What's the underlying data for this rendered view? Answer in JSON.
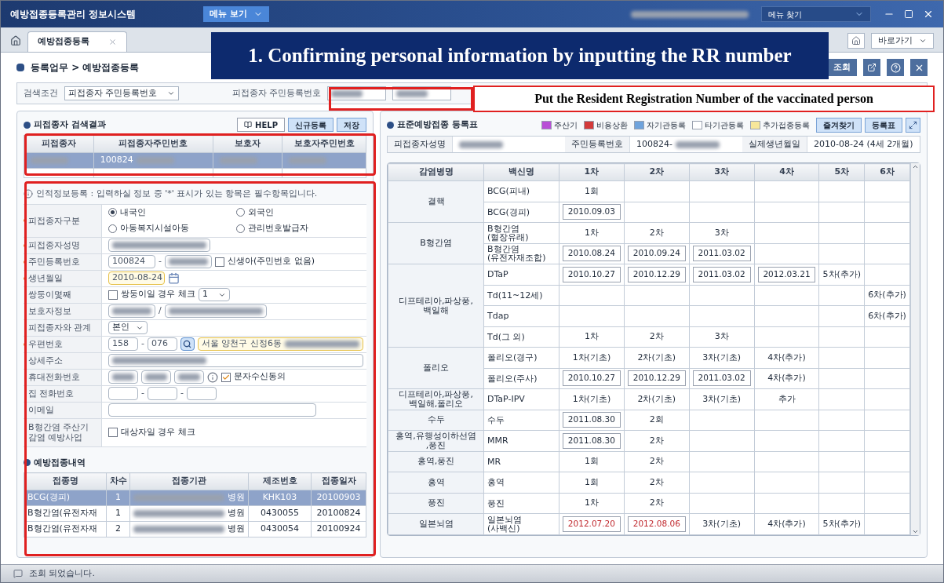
{
  "window": {
    "title": "예방접종등록관리 정보시스템",
    "menu_button": "메뉴 보기",
    "menu_search": "메뉴 찾기"
  },
  "tabs": [
    {
      "label": "예방접종등록",
      "selected": true
    }
  ],
  "shortcut_menu": "바로가기",
  "breadcrumb": "등록업무 > 예방접종등록",
  "toolbar": {
    "search_button": "조회"
  },
  "search": {
    "condition_label": "검색조건",
    "condition_value": "피접종자 주민등록번호",
    "field_label": "피접종자 주민등록번호"
  },
  "annotations": {
    "banner": "1. Confirming personal information by inputting the RR number",
    "callout": "Put the Resident Registration Number of the vaccinated person"
  },
  "results": {
    "title": "피접종자 검색결과",
    "buttons": [
      "HELP",
      "신규등록",
      "저장"
    ],
    "columns": [
      "피접종자",
      "피접종자주민번호",
      "보호자",
      "보호자주민번호"
    ],
    "rows": [
      {
        "selected": true,
        "cells": [
          {
            "blurred": true
          },
          {
            "text": "100824",
            "blurred": true
          },
          {
            "blurred": true
          },
          {
            "blurred": true
          }
        ]
      }
    ]
  },
  "form": {
    "notice": "인적정보등록 : 입력하실 정보 중 '*' 표시가 있는 항목은 필수항목입니다.",
    "rows": [
      {
        "label": "피접종자구분",
        "required": true,
        "kind": "radios",
        "controls": [
          {
            "kind": "radio",
            "label": "내국인",
            "selected": true
          },
          {
            "kind": "radio",
            "label": "외국인",
            "selected": false
          },
          {
            "kind": "radio",
            "label": "아동복지시설아동",
            "selected": false
          },
          {
            "kind": "radio",
            "label": "관리번호발급자",
            "selected": false
          }
        ]
      },
      {
        "label": "피접종자성명",
        "required": true,
        "kind": "line",
        "controls": [
          {
            "kind": "input",
            "blurred": true
          }
        ]
      },
      {
        "label": "주민등록번호",
        "required": true,
        "kind": "line",
        "controls": [
          {
            "kind": "short_input",
            "value": "100824"
          },
          {
            "kind": "sep",
            "text": "-"
          },
          {
            "kind": "short_input",
            "blurred": true
          },
          {
            "kind": "checkbox",
            "label": "신생아(주민번호 없음)",
            "checked": false
          }
        ]
      },
      {
        "label": "생년월일",
        "required": true,
        "kind": "line",
        "controls": [
          {
            "kind": "date_input",
            "value": "2010-08-24"
          },
          {
            "kind": "calendar_button"
          }
        ]
      },
      {
        "label": "쌍둥이몇째",
        "required": false,
        "kind": "line",
        "controls": [
          {
            "kind": "checkbox",
            "label": "쌍둥이일 경우 체크",
            "checked": false
          },
          {
            "kind": "select",
            "value": "1"
          }
        ]
      },
      {
        "label": "보호자정보",
        "required": false,
        "kind": "line",
        "controls": [
          {
            "kind": "short_input",
            "blurred": true
          },
          {
            "kind": "sep",
            "text": "/"
          },
          {
            "kind": "input",
            "blurred": true
          }
        ]
      },
      {
        "label": "피접종자와 관계",
        "required": false,
        "kind": "line",
        "controls": [
          {
            "kind": "select",
            "value": "본인"
          }
        ]
      },
      {
        "label": "우편번호",
        "required": true,
        "kind": "line",
        "controls": [
          {
            "kind": "tiny_input",
            "value": "158"
          },
          {
            "kind": "sep",
            "text": "-"
          },
          {
            "kind": "tiny_input",
            "value": "076"
          },
          {
            "kind": "search_button"
          },
          {
            "kind": "address_input",
            "value": "서울 양천구 신정6동",
            "blurred": true
          }
        ]
      },
      {
        "label": "상세주소",
        "required": false,
        "kind": "line",
        "controls": [
          {
            "kind": "long_input",
            "blurred": true
          }
        ]
      },
      {
        "label": "휴대전화번호",
        "required": false,
        "kind": "line",
        "controls": [
          {
            "kind": "tiny_input",
            "blurred": true
          },
          {
            "kind": "tiny_input",
            "blurred": true
          },
          {
            "kind": "tiny_input",
            "blurred": true
          },
          {
            "kind": "info_icon"
          },
          {
            "kind": "checkbox",
            "label": "문자수신동의",
            "checked": true
          }
        ]
      },
      {
        "label": "집 전화번호",
        "required": false,
        "kind": "line",
        "controls": [
          {
            "kind": "tiny_input"
          },
          {
            "kind": "sep",
            "text": "-"
          },
          {
            "kind": "tiny_input"
          },
          {
            "kind": "sep",
            "text": "-"
          },
          {
            "kind": "tiny_input"
          }
        ]
      },
      {
        "label": "이메일",
        "required": false,
        "kind": "line",
        "controls": [
          {
            "kind": "wide_input"
          }
        ]
      },
      {
        "label": "B형간염 주산기\n감염 예방사업",
        "required": false,
        "kind": "tall",
        "controls": [
          {
            "kind": "checkbox",
            "label": "대상자일 경우 체크",
            "checked": false
          }
        ]
      }
    ]
  },
  "history": {
    "title": "예방접종내역",
    "columns": [
      "접종명",
      "차수",
      "접종기관",
      "제조번호",
      "접종일자"
    ],
    "rows": [
      {
        "selected": true,
        "cells": [
          {
            "text": "BCG(경피)"
          },
          {
            "text": "1"
          },
          {
            "text": "병원",
            "blurred": true
          },
          {
            "text": "KHK103"
          },
          {
            "text": "20100903"
          }
        ]
      },
      {
        "selected": false,
        "cells": [
          {
            "text": "B형간염(유전자재"
          },
          {
            "text": "1"
          },
          {
            "text": "병원",
            "blurred": true
          },
          {
            "text": "0430055"
          },
          {
            "text": "20100824"
          }
        ]
      },
      {
        "selected": false,
        "cells": [
          {
            "text": "B형간염(유전자재"
          },
          {
            "text": "2"
          },
          {
            "text": "병원",
            "blurred": true
          },
          {
            "text": "0430054"
          },
          {
            "text": "20100924"
          }
        ]
      }
    ]
  },
  "register": {
    "title": "표준예방접종 등록표",
    "legend": [
      {
        "label": "주산기",
        "color": "#b84fd6"
      },
      {
        "label": "비용상환",
        "color": "#d33a3a"
      },
      {
        "label": "자기관등록",
        "color": "#6fa3dc"
      },
      {
        "label": "타기관등록",
        "color": "#ffffff"
      },
      {
        "label": "추가접종등록",
        "color": "#f7e79a"
      }
    ],
    "buttons": [
      "즐겨찾기",
      "등록표"
    ],
    "info": [
      {
        "label": "피접종자성명",
        "blurred": true
      },
      {
        "label": "주민등록번호",
        "value": "100824-",
        "blurred": true
      },
      {
        "label": "실제생년월일",
        "value": "2010-08-24 (4세 2개월)"
      }
    ],
    "columns": [
      "감염병명",
      "백신명",
      "1차",
      "2차",
      "3차",
      "4차",
      "5차",
      "6차"
    ],
    "groups": [
      {
        "disease": "결핵",
        "vaccines": [
          {
            "name": "BCG(피내)",
            "doses": [
              {
                "text": "1회",
                "kind": "label"
              },
              {
                "kind": "empty"
              },
              {
                "kind": "empty"
              },
              {
                "kind": "empty"
              },
              {
                "kind": "empty"
              },
              {
                "kind": "empty"
              }
            ]
          },
          {
            "name": "BCG(경피)",
            "doses": [
              {
                "text": "2010.09.03",
                "kind": "date"
              },
              {
                "kind": "empty"
              },
              {
                "kind": "empty"
              },
              {
                "kind": "empty"
              },
              {
                "kind": "empty"
              },
              {
                "kind": "empty"
              }
            ]
          }
        ]
      },
      {
        "disease": "B형간염",
        "vaccines": [
          {
            "name": "B형간염\n(혈장유래)",
            "doses": [
              {
                "text": "1차",
                "kind": "label"
              },
              {
                "text": "2차",
                "kind": "label"
              },
              {
                "text": "3차",
                "kind": "label"
              },
              {
                "kind": "empty"
              },
              {
                "kind": "empty"
              },
              {
                "kind": "empty"
              }
            ]
          },
          {
            "name": "B형간염\n(유전자재조합)",
            "doses": [
              {
                "text": "2010.08.24",
                "kind": "date"
              },
              {
                "text": "2010.09.24",
                "kind": "date"
              },
              {
                "text": "2011.03.02",
                "kind": "date"
              },
              {
                "kind": "empty"
              },
              {
                "kind": "empty"
              },
              {
                "kind": "empty"
              }
            ]
          }
        ]
      },
      {
        "disease": "디프테리아,파상풍,\n백일해",
        "vaccines": [
          {
            "name": "DTaP",
            "doses": [
              {
                "text": "2010.10.27",
                "kind": "date"
              },
              {
                "text": "2010.12.29",
                "kind": "date"
              },
              {
                "text": "2011.03.02",
                "kind": "date"
              },
              {
                "text": "2012.03.21",
                "kind": "date"
              },
              {
                "text": "5차(추가)",
                "kind": "label"
              },
              {
                "kind": "empty"
              }
            ]
          },
          {
            "name": "Td(11~12세)",
            "doses": [
              {
                "kind": "empty"
              },
              {
                "kind": "empty"
              },
              {
                "kind": "empty"
              },
              {
                "kind": "empty"
              },
              {
                "kind": "empty"
              },
              {
                "text": "6차(추가)",
                "kind": "label"
              }
            ]
          },
          {
            "name": "Tdap",
            "doses": [
              {
                "kind": "empty"
              },
              {
                "kind": "empty"
              },
              {
                "kind": "empty"
              },
              {
                "kind": "empty"
              },
              {
                "kind": "empty"
              },
              {
                "text": "6차(추가)",
                "kind": "label"
              }
            ]
          },
          {
            "name": "Td(그 외)",
            "doses": [
              {
                "text": "1차",
                "kind": "label"
              },
              {
                "text": "2차",
                "kind": "label"
              },
              {
                "text": "3차",
                "kind": "label"
              },
              {
                "kind": "empty"
              },
              {
                "kind": "empty"
              },
              {
                "kind": "empty"
              }
            ]
          }
        ]
      },
      {
        "disease": "폴리오",
        "vaccines": [
          {
            "name": "폴리오(경구)",
            "doses": [
              {
                "text": "1차(기초)",
                "kind": "label"
              },
              {
                "text": "2차(기초)",
                "kind": "label"
              },
              {
                "text": "3차(기초)",
                "kind": "label"
              },
              {
                "text": "4차(추가)",
                "kind": "label"
              },
              {
                "kind": "empty"
              },
              {
                "kind": "empty"
              }
            ]
          },
          {
            "name": "폴리오(주사)",
            "doses": [
              {
                "text": "2010.10.27",
                "kind": "date"
              },
              {
                "text": "2010.12.29",
                "kind": "date"
              },
              {
                "text": "2011.03.02",
                "kind": "date"
              },
              {
                "text": "4차(추가)",
                "kind": "label"
              },
              {
                "kind": "empty"
              },
              {
                "kind": "empty"
              }
            ]
          }
        ]
      },
      {
        "disease": "디프테리아,파상풍,\n백일해,폴리오",
        "vaccines": [
          {
            "name": "DTaP-IPV",
            "doses": [
              {
                "text": "1차(기초)",
                "kind": "label"
              },
              {
                "text": "2차(기초)",
                "kind": "label"
              },
              {
                "text": "3차(기초)",
                "kind": "label"
              },
              {
                "text": "추가",
                "kind": "label"
              },
              {
                "kind": "empty"
              },
              {
                "kind": "empty"
              }
            ]
          }
        ]
      },
      {
        "disease": "수두",
        "vaccines": [
          {
            "name": "수두",
            "doses": [
              {
                "text": "2011.08.30",
                "kind": "date"
              },
              {
                "text": "2회",
                "kind": "label"
              },
              {
                "kind": "empty"
              },
              {
                "kind": "empty"
              },
              {
                "kind": "empty"
              },
              {
                "kind": "empty"
              }
            ]
          }
        ]
      },
      {
        "disease": "홍역,유행성이하선염\n,풍진",
        "vaccines": [
          {
            "name": "MMR",
            "doses": [
              {
                "text": "2011.08.30",
                "kind": "date"
              },
              {
                "text": "2차",
                "kind": "label"
              },
              {
                "kind": "empty"
              },
              {
                "kind": "empty"
              },
              {
                "kind": "empty"
              },
              {
                "kind": "empty"
              }
            ]
          }
        ]
      },
      {
        "disease": "홍역,풍진",
        "vaccines": [
          {
            "name": "MR",
            "doses": [
              {
                "text": "1회",
                "kind": "label"
              },
              {
                "text": "2차",
                "kind": "label"
              },
              {
                "kind": "empty"
              },
              {
                "kind": "empty"
              },
              {
                "kind": "empty"
              },
              {
                "kind": "empty"
              }
            ]
          }
        ]
      },
      {
        "disease": "홍역",
        "vaccines": [
          {
            "name": "홍역",
            "doses": [
              {
                "text": "1회",
                "kind": "label"
              },
              {
                "text": "2차",
                "kind": "label"
              },
              {
                "kind": "empty"
              },
              {
                "kind": "empty"
              },
              {
                "kind": "empty"
              },
              {
                "kind": "empty"
              }
            ]
          }
        ]
      },
      {
        "disease": "풍진",
        "vaccines": [
          {
            "name": "풍진",
            "doses": [
              {
                "text": "1차",
                "kind": "label"
              },
              {
                "text": "2차",
                "kind": "label"
              },
              {
                "kind": "empty"
              },
              {
                "kind": "empty"
              },
              {
                "kind": "empty"
              },
              {
                "kind": "empty"
              }
            ]
          }
        ]
      },
      {
        "disease": "일본뇌염",
        "vaccines": [
          {
            "name": "일본뇌염\n(사백신)",
            "doses": [
              {
                "text": "2012.07.20",
                "kind": "alert_date"
              },
              {
                "text": "2012.08.06",
                "kind": "alert_date"
              },
              {
                "text": "3차(기초)",
                "kind": "label"
              },
              {
                "text": "4차(추가)",
                "kind": "label"
              },
              {
                "text": "5차(추가)",
                "kind": "label"
              },
              {
                "kind": "empty"
              }
            ]
          }
        ]
      }
    ]
  },
  "status_bar": "조회 되었습니다."
}
